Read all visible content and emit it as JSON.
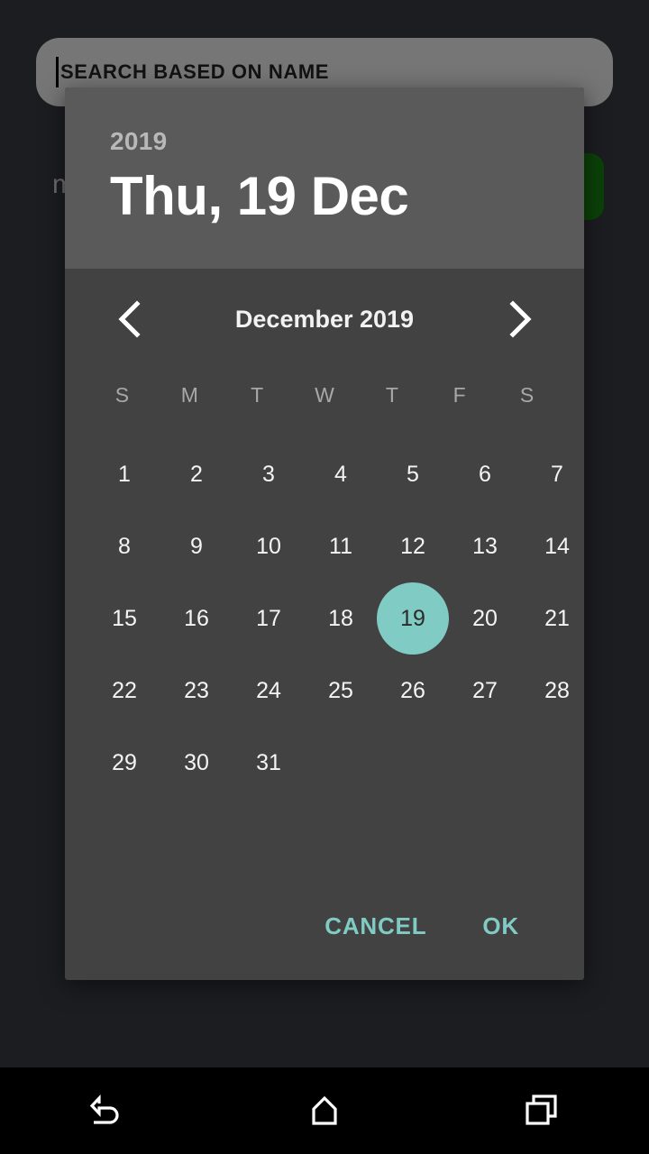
{
  "background": {
    "search": {
      "placeholder": "SEARCH BASED ON NAME",
      "value": ""
    },
    "list_text": "m",
    "green_button_color": "#0b4208"
  },
  "dialog": {
    "header": {
      "year": "2019",
      "selected_date_label": "Thu, 19 Dec"
    },
    "month_nav": {
      "previous_label": "‹",
      "next_label": "›",
      "month_label": "December 2019"
    },
    "weekdays": [
      "S",
      "M",
      "T",
      "W",
      "T",
      "F",
      "S"
    ],
    "leading_blanks": 0,
    "days": [
      1,
      2,
      3,
      4,
      5,
      6,
      7,
      8,
      9,
      10,
      11,
      12,
      13,
      14,
      15,
      16,
      17,
      18,
      19,
      20,
      21,
      22,
      23,
      24,
      25,
      26,
      27,
      28,
      29,
      30,
      31
    ],
    "selected_day": 19,
    "actions": {
      "cancel_label": "CANCEL",
      "ok_label": "OK"
    },
    "colors": {
      "header_background": "#5a5a5a",
      "body_background": "#424242",
      "accent": "#80cbc4",
      "selected_text": "#2b2b2b",
      "day_text": "#f4f4f4",
      "weekday_text": "#a8a8a8"
    }
  },
  "android_nav": {
    "back_label": "back-button",
    "home_label": "home-button",
    "recents_label": "recents-button"
  }
}
